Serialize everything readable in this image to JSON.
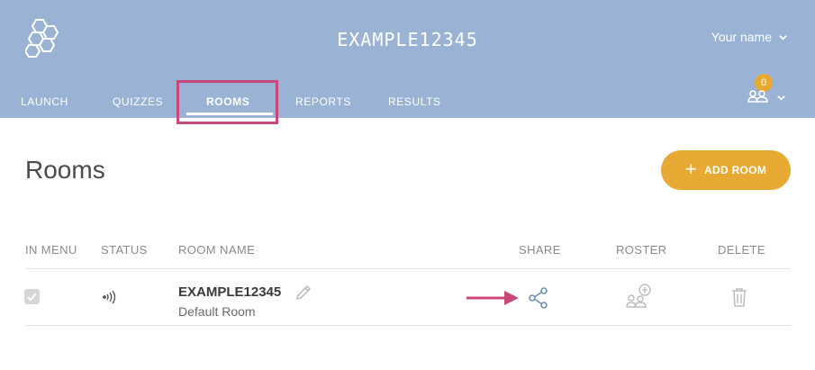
{
  "header": {
    "title": "EXAMPLE12345",
    "user_name": "Your name",
    "notification_count": "0",
    "logo_icon": "hexagon-cluster-logo",
    "background_color": "#9ab3d5"
  },
  "tabs": [
    {
      "label": "LAUNCH",
      "active": false
    },
    {
      "label": "QUIZZES",
      "active": false
    },
    {
      "label": "ROOMS",
      "active": true
    },
    {
      "label": "REPORTS",
      "active": false
    },
    {
      "label": "RESULTS",
      "active": false
    }
  ],
  "page": {
    "title": "Rooms",
    "add_button_label": "ADD ROOM",
    "add_button_color": "#e8a933"
  },
  "table": {
    "columns": [
      "IN MENU",
      "STATUS",
      "ROOM NAME",
      "SHARE",
      "ROSTER",
      "DELETE"
    ],
    "rows": [
      {
        "in_menu": true,
        "status_icon": "signal-icon",
        "room_name": "EXAMPLE12345",
        "room_subtitle": "Default Room"
      }
    ]
  },
  "annotations": {
    "highlight_color": "#c9487c"
  }
}
